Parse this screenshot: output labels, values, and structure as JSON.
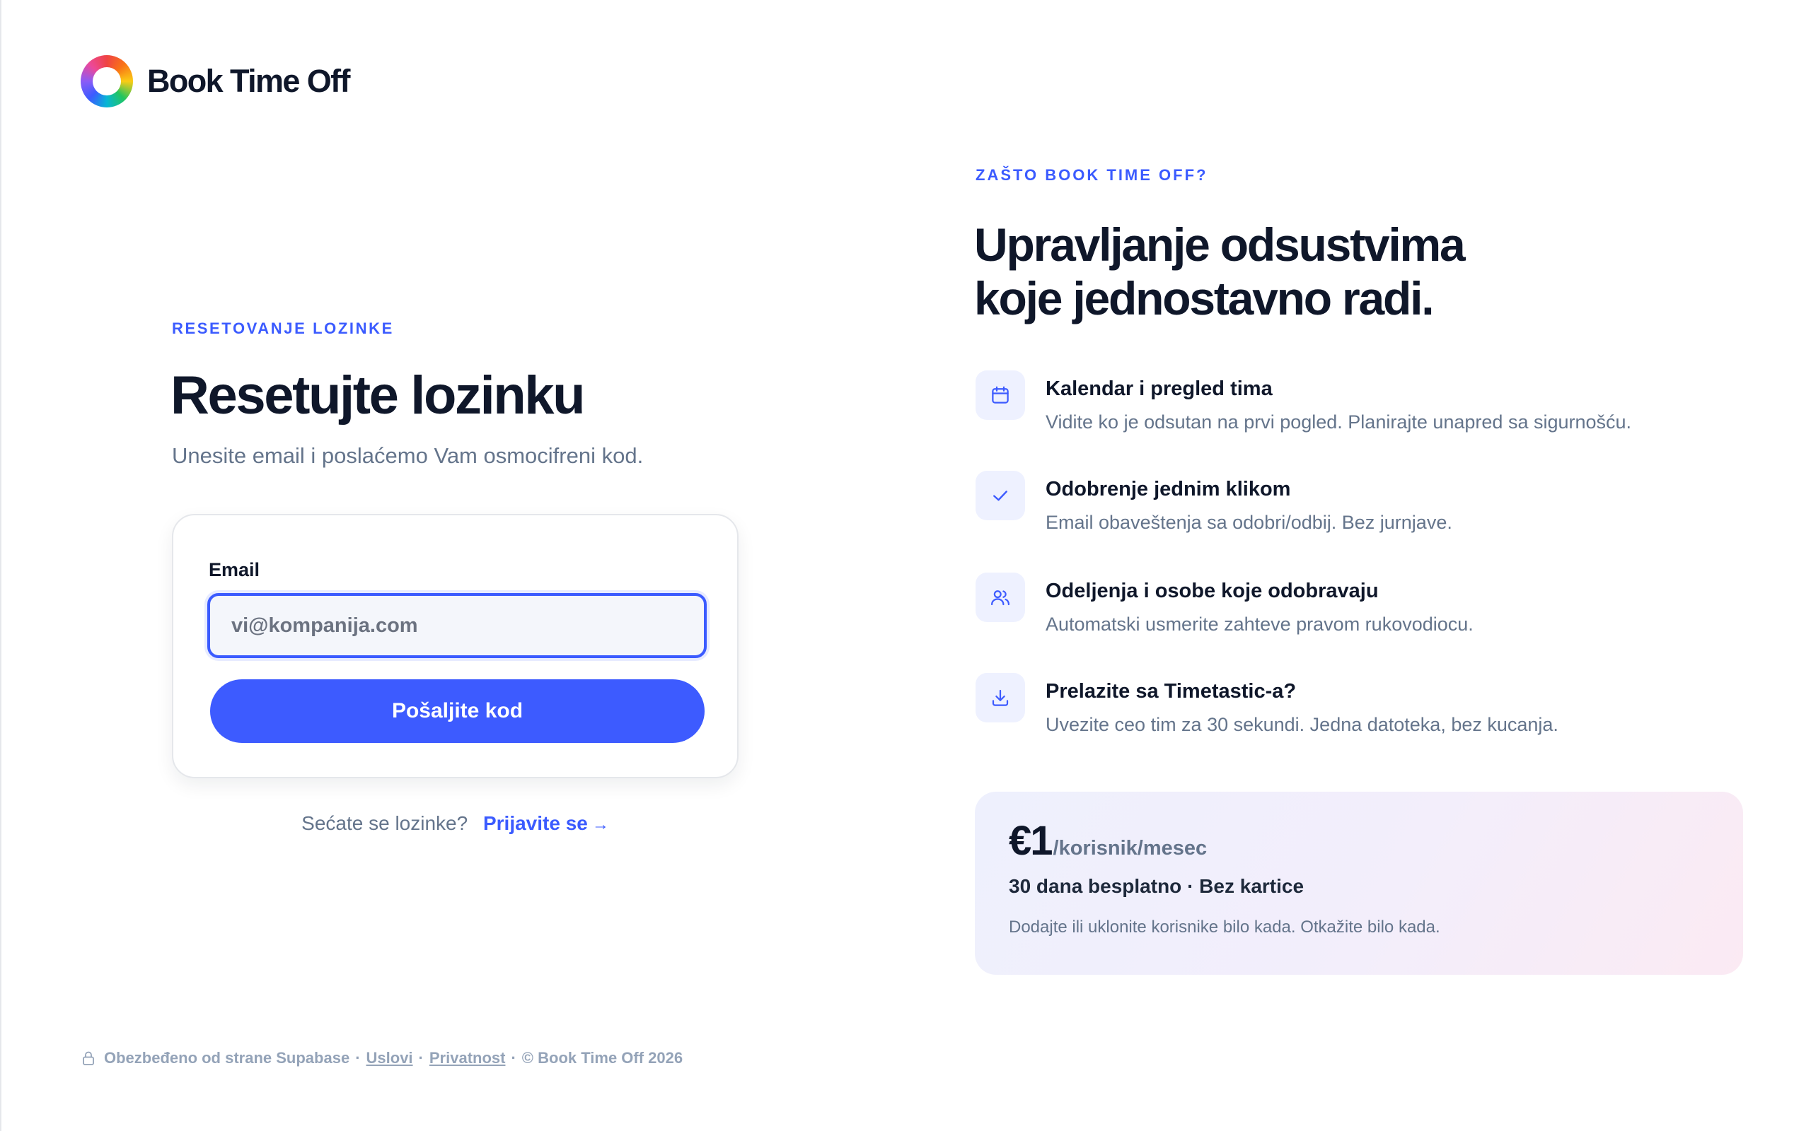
{
  "brand": {
    "name": "Book Time Off",
    "logo_icon": "rainbow-ring-logo"
  },
  "reset": {
    "eyebrow": "RESETOVANJE LOZINKE",
    "title": "Resetujte lozinku",
    "subtitle": "Unesite email i poslaćemo Vam osmocifreni kod.",
    "email_label": "Email",
    "email_value": "",
    "email_placeholder": "vi@kompanija.com",
    "submit_label": "Pošaljite kod",
    "remember_text": "Sećate se lozinke?",
    "signin_label": "Prijavite se",
    "signin_arrow": "→"
  },
  "why": {
    "eyebrow": "ZAŠTO BOOK TIME OFF?",
    "title_line1": "Upravljanje odsustvima",
    "title_line2": "koje jednostavno radi.",
    "features": [
      {
        "icon": "calendar-icon",
        "title": "Kalendar i pregled tima",
        "desc": "Vidite ko je odsutan na prvi pogled. Planirajte unapred sa sigurnošću."
      },
      {
        "icon": "check-icon",
        "title": "Odobrenje jednim klikom",
        "desc": "Email obaveštenja sa odobri/odbij. Bez jurnjave."
      },
      {
        "icon": "users-icon",
        "title": "Odeljenja i osobe koje odobravaju",
        "desc": "Automatski usmerite zahteve pravom rukovodiocu."
      },
      {
        "icon": "download-icon",
        "title": "Prelazite sa Timetastic-a?",
        "desc": "Uvezite ceo tim za 30 sekundi. Jedna datoteka, bez kucanja."
      }
    ]
  },
  "pricing": {
    "amount": "€1",
    "unit": "/korisnik/mesec",
    "trial": "30 dana besplatno · Bez kartice",
    "note": "Dodajte ili uklonite korisnike bilo kada. Otkažite bilo kada."
  },
  "footer": {
    "secured": "Obezbeđeno od strane Supabase",
    "sep": "·",
    "terms": "Uslovi",
    "privacy": "Privatnost",
    "copyright": "© Book Time Off 2026"
  },
  "colors": {
    "accent": "#3d5bff",
    "heading": "#0f172a",
    "muted": "#64748b",
    "icon_bg": "#eef1ff"
  }
}
